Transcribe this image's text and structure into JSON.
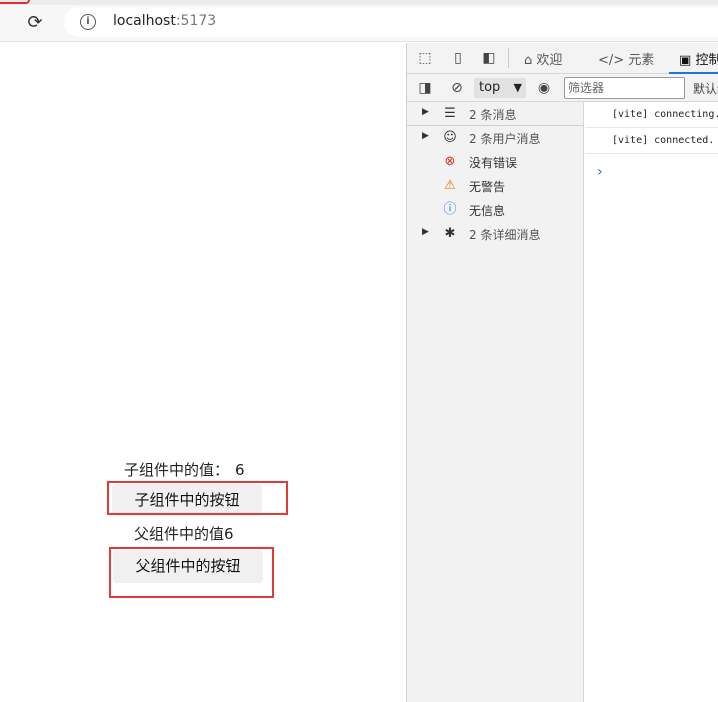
{
  "browser": {
    "url_host": "localhost",
    "url_port": ":5173"
  },
  "page": {
    "child_value_label": "子组件中的值：",
    "child_value": "6",
    "child_button": "子组件中的按钮",
    "parent_value_text": "父组件中的值6",
    "parent_button": "父组件中的按钮"
  },
  "devtools": {
    "tabs": [
      {
        "label": "欢迎",
        "icon": "home-icon"
      },
      {
        "label": "元素",
        "icon": "code-icon"
      },
      {
        "label": "控制",
        "icon": "console-icon"
      }
    ],
    "context": "top",
    "filter_placeholder": "筛选器",
    "levels_label": "默认级",
    "sidebar": [
      {
        "label": "2 条消息",
        "icon": "list-icon",
        "expandable": true
      },
      {
        "label": "2 条用户消息",
        "icon": "user-icon",
        "expandable": true
      },
      {
        "label": "没有错误",
        "icon": "error-icon",
        "expandable": false
      },
      {
        "label": "无警告",
        "icon": "warning-icon",
        "expandable": false
      },
      {
        "label": "无信息",
        "icon": "info-icon",
        "expandable": false
      },
      {
        "label": "2 条详细消息",
        "icon": "bug-icon",
        "expandable": true
      }
    ],
    "logs": [
      "[vite] connecting...",
      "[vite] connected."
    ]
  },
  "colors": {
    "highlight_box": "#e53935",
    "devtools_accent": "#1a73e8"
  }
}
